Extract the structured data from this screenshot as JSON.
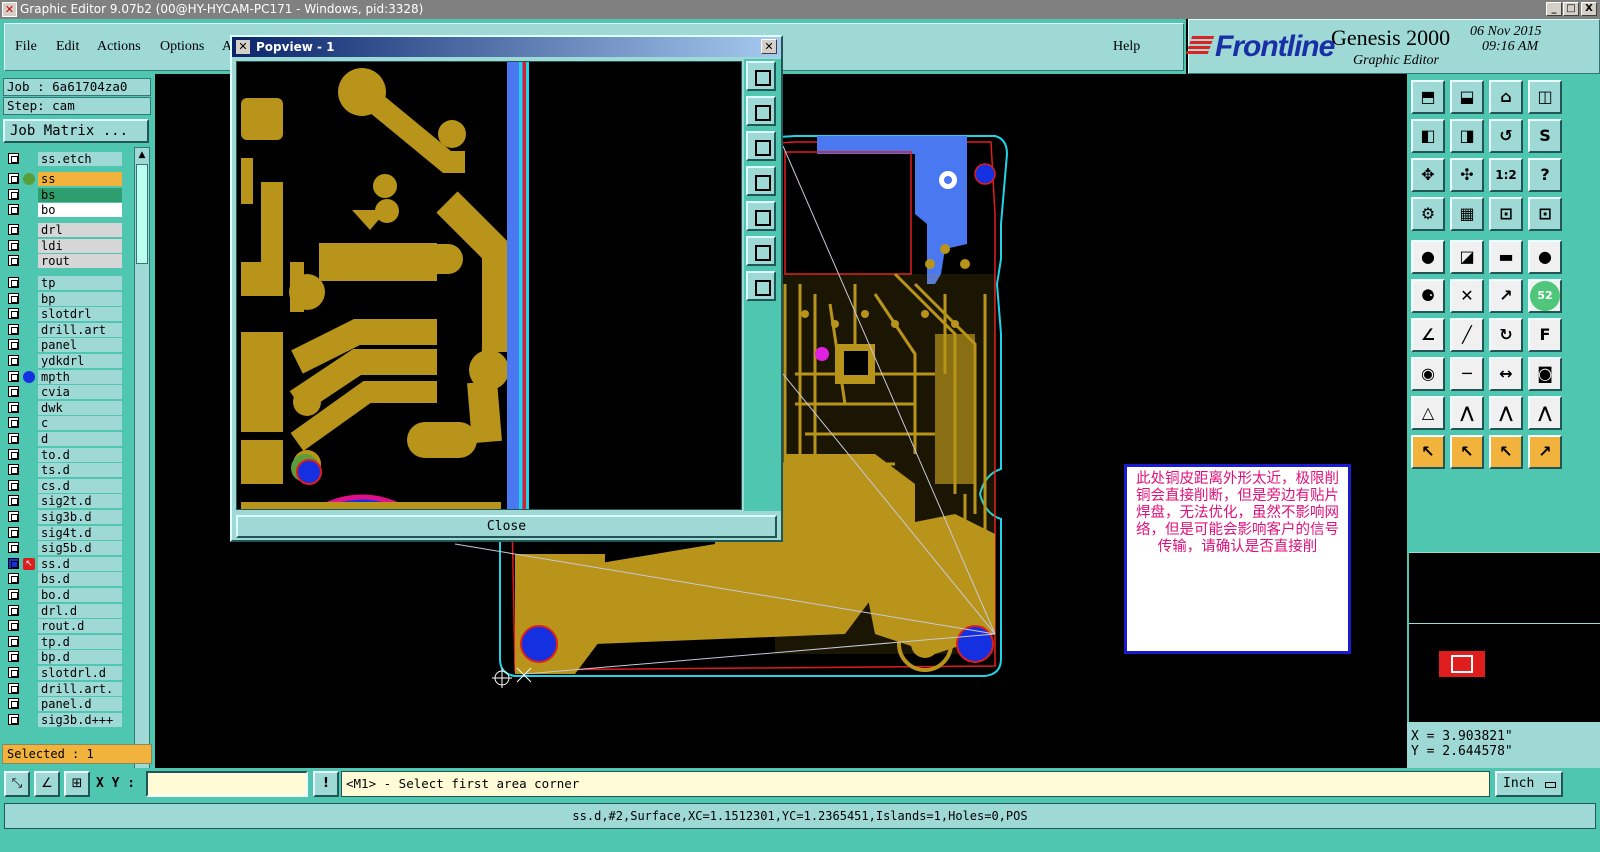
{
  "window": {
    "title": "Graphic Editor 9.07b2 (00@HY-HYCAM-PC171 - Windows, pid:3328)",
    "min_btn": "_",
    "max_btn": "□",
    "close_btn": "X"
  },
  "menu": {
    "file": "File",
    "edit": "Edit",
    "actions": "Actions",
    "options": "Options",
    "truncated": "A",
    "help": "Help"
  },
  "brand": {
    "logo": "Frontline",
    "product": "Genesis 2000",
    "subtitle": "Graphic Editor",
    "date": "06 Nov 2015",
    "time": "09:16 AM"
  },
  "job": {
    "job_label": "Job : 6a61704za0",
    "step_label": "Step: cam",
    "matrix_button": "Job Matrix ..."
  },
  "layers": [
    {
      "name": "ss.etch",
      "dot": "",
      "mark": "",
      "hi": false
    },
    {
      "name": "ss",
      "dot": "#5a9e3a",
      "mark": "✎",
      "hi": false,
      "color": "#f2b33d"
    },
    {
      "name": "bs",
      "dot": "",
      "mark": "✎",
      "hi": false,
      "color": "#2f9e6e"
    },
    {
      "name": "bo",
      "dot": "",
      "mark": "✎",
      "hi": false,
      "color": "#ffffff"
    },
    {
      "name": "drl",
      "dot": "",
      "mark": "",
      "hi": true
    },
    {
      "name": "ldi",
      "dot": "",
      "mark": "",
      "hi": true
    },
    {
      "name": "rout",
      "dot": "",
      "mark": "",
      "hi": true
    },
    {
      "name": "tp",
      "dot": "",
      "mark": "✎",
      "hi": false
    },
    {
      "name": "bp",
      "dot": "",
      "mark": "✎",
      "hi": false
    },
    {
      "name": "slotdrl",
      "dot": "",
      "mark": "",
      "hi": false
    },
    {
      "name": "drill.art",
      "dot": "",
      "mark": "✎",
      "hi": false
    },
    {
      "name": "panel",
      "dot": "",
      "mark": "✎",
      "hi": false
    },
    {
      "name": "ydkdrl",
      "dot": "",
      "mark": "",
      "hi": false
    },
    {
      "name": "mpth",
      "dot": "#1530e0",
      "mark": "",
      "hi": false
    },
    {
      "name": "cvia",
      "dot": "",
      "mark": "",
      "hi": false
    },
    {
      "name": "dwk",
      "dot": "",
      "mark": "",
      "hi": false
    },
    {
      "name": "c",
      "dot": "",
      "mark": "",
      "hi": false
    },
    {
      "name": "d",
      "dot": "",
      "mark": "",
      "hi": false
    },
    {
      "name": "to.d",
      "dot": "",
      "mark": "✎",
      "hi": false
    },
    {
      "name": "ts.d",
      "dot": "",
      "mark": "✎",
      "hi": false
    },
    {
      "name": "cs.d",
      "dot": "",
      "mark": "✎",
      "hi": false
    },
    {
      "name": "sig2t.d",
      "dot": "",
      "mark": "✎",
      "hi": false
    },
    {
      "name": "sig3b.d",
      "dot": "",
      "mark": "✎",
      "hi": false
    },
    {
      "name": "sig4t.d",
      "dot": "",
      "mark": "✎",
      "hi": false
    },
    {
      "name": "sig5b.d",
      "dot": "",
      "mark": "✎",
      "hi": false
    },
    {
      "name": "ss.d",
      "dot": "",
      "mark": "✎",
      "hi": false,
      "active": true
    },
    {
      "name": "bs.d",
      "dot": "",
      "mark": "✎",
      "hi": false
    },
    {
      "name": "bo.d",
      "dot": "",
      "mark": "✎",
      "hi": false
    },
    {
      "name": "drl.d",
      "dot": "",
      "mark": "",
      "hi": false
    },
    {
      "name": "rout.d",
      "dot": "",
      "mark": "",
      "hi": false
    },
    {
      "name": "tp.d",
      "dot": "",
      "mark": "✎",
      "hi": false
    },
    {
      "name": "bp.d",
      "dot": "",
      "mark": "✎",
      "hi": false
    },
    {
      "name": "slotdrl.d",
      "dot": "",
      "mark": "",
      "hi": false
    },
    {
      "name": "drill.art.",
      "dot": "",
      "mark": "✎",
      "hi": false
    },
    {
      "name": "panel.d",
      "dot": "",
      "mark": "✎",
      "hi": false
    },
    {
      "name": "sig3b.d+++",
      "dot": "",
      "mark": "✎",
      "hi": false
    }
  ],
  "selected": "Selected : 1",
  "popview": {
    "title": "Popview - 1",
    "close_button": "Close"
  },
  "note": {
    "text": "此处铜皮距离外形太近，极限削铜会直接削断，但是旁边有贴片焊盘，无法优化，虽然不影响网络，但是可能会影响客户的信号传输，请确认是否直接削"
  },
  "right_tools": {
    "ratio_label": "1:2",
    "question_label": "?",
    "badge": "52"
  },
  "coords": {
    "x": "X = 3.903821\"",
    "y": "Y = 2.644578\""
  },
  "command": {
    "xy_label": "X Y :",
    "xy_value": "",
    "bang": "!",
    "prompt": "<M1> - Select first area corner",
    "units": "Inch"
  },
  "status": {
    "text": "ss.d,#2,Surface,XC=1.1512301,YC=1.2365451,Islands=1,Holes=0,POS"
  },
  "colors": {
    "panel_teal": "#4fc7b0",
    "button_teal": "#9ed9d6",
    "copper": "#b8941a",
    "pad_blue": "#1530e0",
    "highlight_orange": "#f2b33d"
  }
}
